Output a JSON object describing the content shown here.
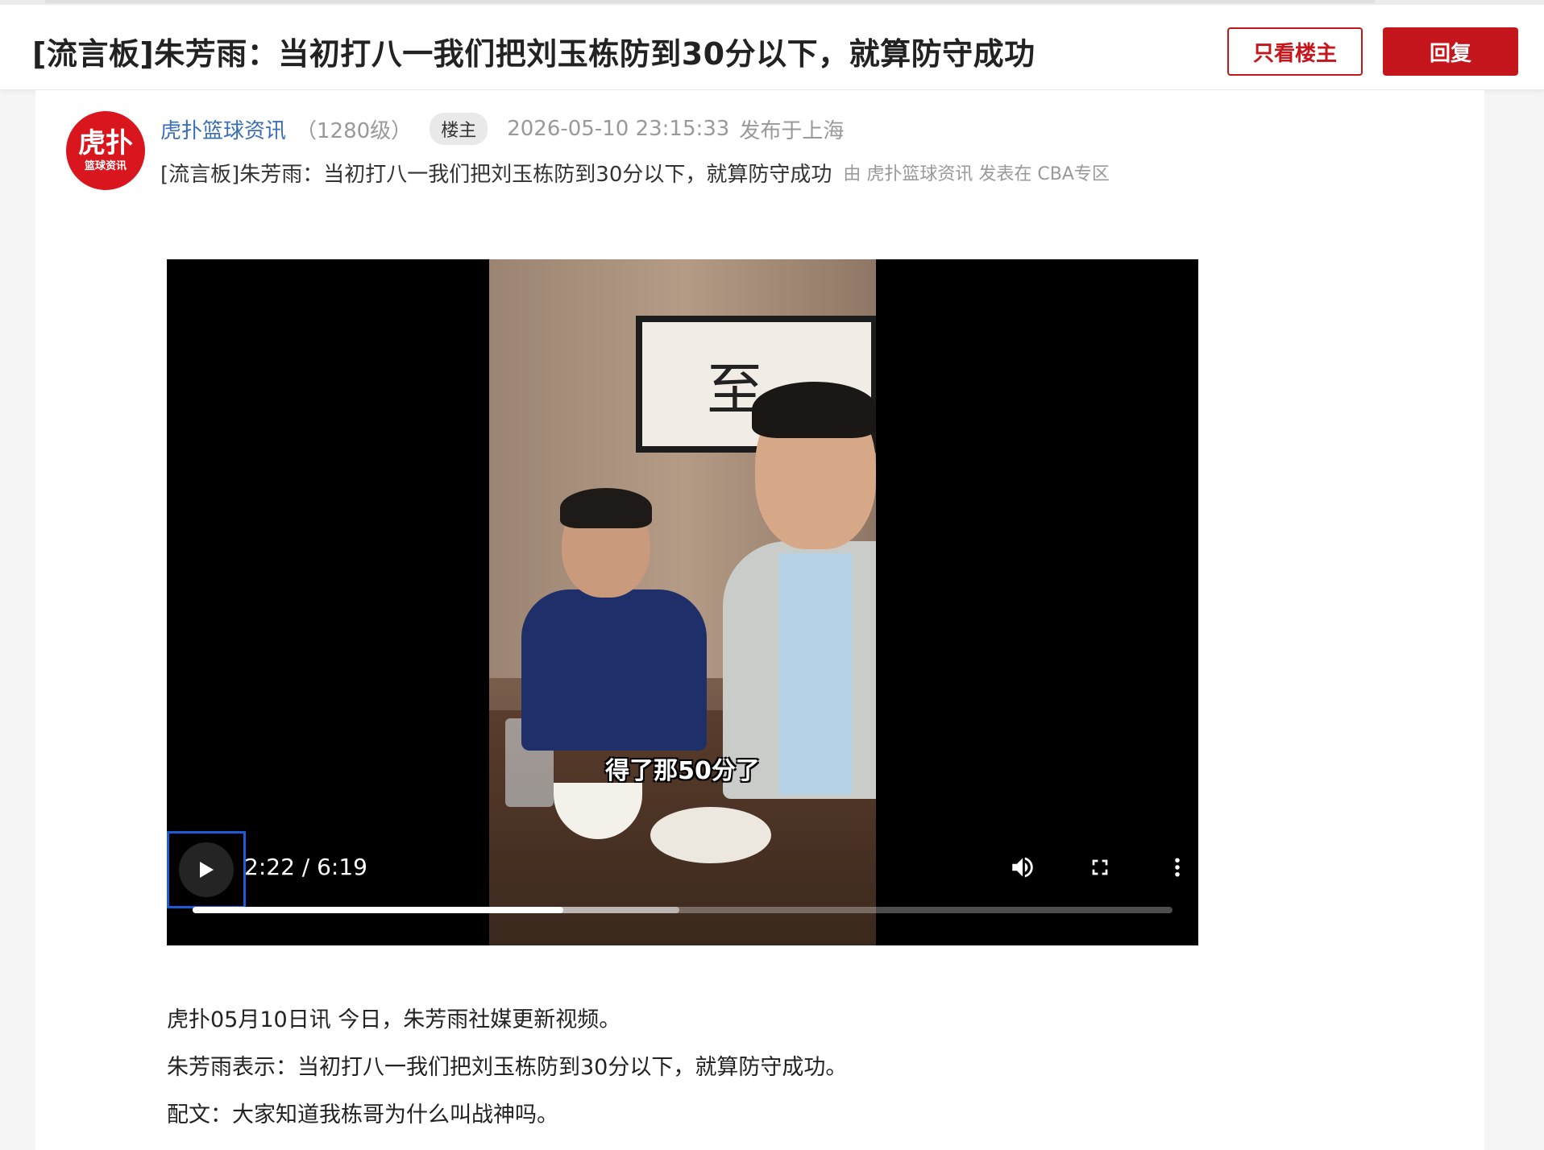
{
  "header": {
    "title": "[流言板]朱芳雨：当初打八一我们把刘玉栋防到30分以下，就算防守成功",
    "only_op_label": "只看楼主",
    "reply_label": "回复"
  },
  "post": {
    "avatar_main": "虎扑",
    "avatar_sub": "篮球资讯",
    "author": "虎扑篮球资讯",
    "level": "（1280级）",
    "op_badge": "楼主",
    "time": "2026-05-10 23:15:33",
    "location": "发布于上海",
    "sub_title": "[流言板]朱芳雨：当初打八一我们把刘玉栋防到30分以下，就算防守成功",
    "by_label": "由",
    "by_author": "虎扑篮球资讯",
    "posted_in_label": "发表在",
    "board": "CBA专区"
  },
  "video": {
    "caption": "得了那50分了",
    "painting_text": "至",
    "current_time": "2:22",
    "duration": "6:19",
    "time_display": "2:22 / 6:19",
    "progress_played": 0.378,
    "progress_buffered": 0.497,
    "icons": [
      "play-icon",
      "volume-icon",
      "fullscreen-icon",
      "more-vert-icon"
    ]
  },
  "body": {
    "paragraphs": [
      "虎扑05月10日讯 今日，朱芳雨社媒更新视频。",
      "朱芳雨表示：当初打八一我们把刘玉栋防到30分以下，就算防守成功。",
      "配文：大家知道我栋哥为什么叫战神吗。"
    ]
  },
  "colors": {
    "accent": "#c6161d",
    "link": "#3a6fb8",
    "focus": "#1e5bd6"
  }
}
